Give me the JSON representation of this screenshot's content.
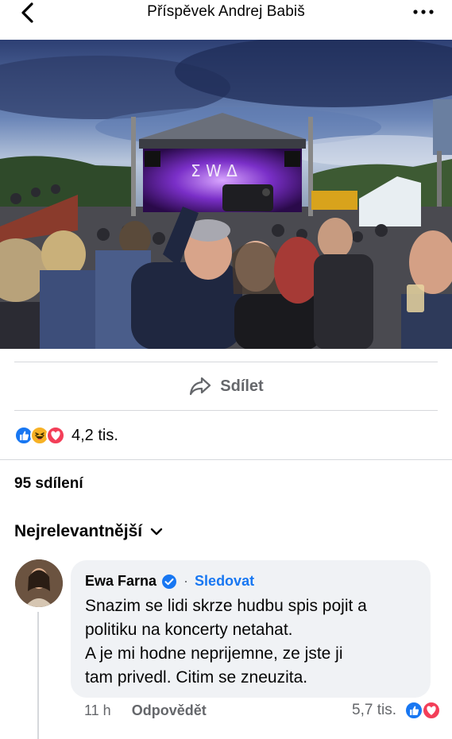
{
  "header": {
    "title": "Příspěvek Andrej Babiš",
    "back_icon": "chevron-left-icon",
    "more_icon": "more-horizontal-icon"
  },
  "post": {
    "photo_description_icon": "photo-concert-selfie",
    "share_label": "Sdílet",
    "reactions": [
      "like",
      "haha",
      "love"
    ],
    "reaction_count": "4,2 tis.",
    "shares_label": "95 sdílení"
  },
  "comments": {
    "sort_label": "Nejrelevantnější",
    "items": [
      {
        "author": "Ewa Farna",
        "verified": true,
        "follow_label": "Sledovat",
        "separator": "·",
        "text": "Snazim se lidi skrze hudbu spis pojit a\npolitiku na koncerty netahat.\nA je mi hodne neprijemne, ze jste ji\ntam privedl. Citim se zneuzita.",
        "time": "11 h",
        "reply_label": "Odpovědět",
        "reaction_count": "5,7 tis.",
        "reactions": [
          "like",
          "love"
        ]
      }
    ]
  },
  "colors": {
    "accent": "#1877f2",
    "secondary_text": "#65676b",
    "bubble": "#f0f2f5",
    "like": "#1877f2",
    "love": "#f33e58",
    "haha": "#f7b125"
  }
}
